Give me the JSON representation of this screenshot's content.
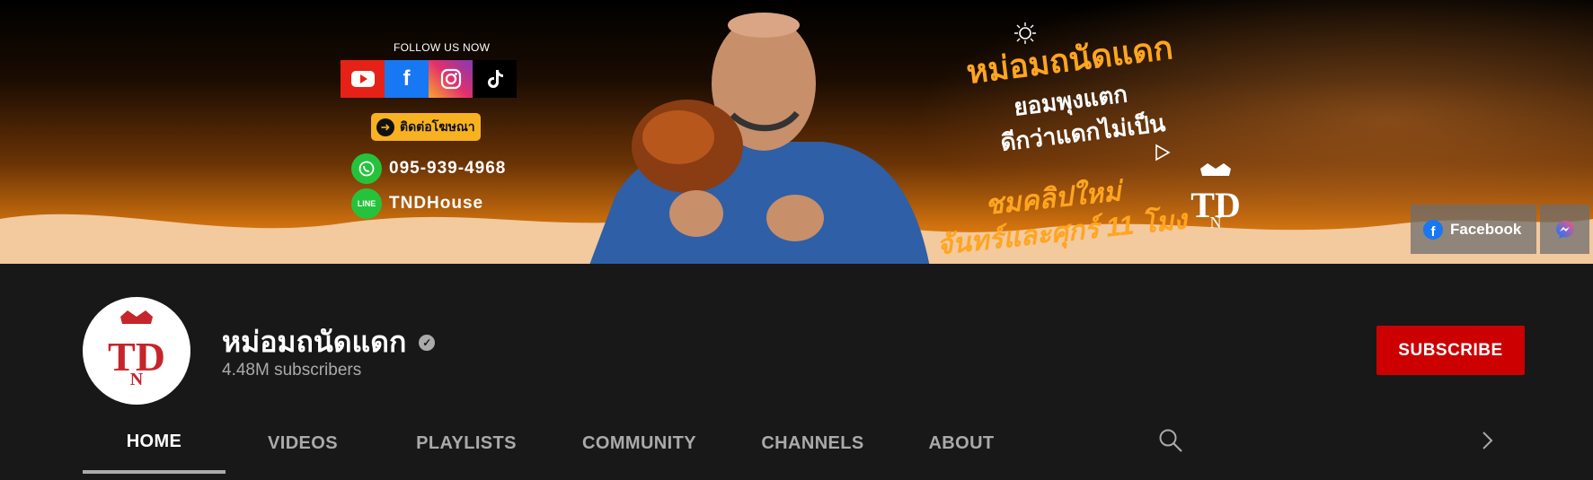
{
  "banner": {
    "follow_label": "FOLLOW US NOW",
    "social_icons": [
      "youtube-icon",
      "facebook-icon",
      "instagram-icon",
      "tiktok-icon"
    ],
    "cta_label": "ติดต่อโฆษณา",
    "phone": "095-939-4968",
    "line_id": "TNDHouse",
    "line_label": "LINE",
    "title": "หม่อมถนัดแดก",
    "tagline_1": "ยอมพุงแตก",
    "tagline_2": "ดีกว่าแดกไม่เป็น",
    "schedule_1": "ชมคลิปใหม่",
    "schedule_2": "จันทร์และศุกร์ 11 โมง",
    "link_facebook": "Facebook"
  },
  "channel": {
    "name": "หม่อมถนัดแดก",
    "subscribers": "4.48M subscribers",
    "subscribe_label": "SUBSCRIBE"
  },
  "tabs": [
    {
      "label": "HOME",
      "active": true
    },
    {
      "label": "VIDEOS",
      "active": false
    },
    {
      "label": "PLAYLISTS",
      "active": false
    },
    {
      "label": "COMMUNITY",
      "active": false
    },
    {
      "label": "CHANNELS",
      "active": false
    },
    {
      "label": "ABOUT",
      "active": false
    }
  ],
  "colors": {
    "background": "#181818",
    "subscribe": "#cc0000",
    "banner_accent": "#ffa51f",
    "tab_active": "#ffffff",
    "tab_inactive": "#aaaaaa"
  }
}
